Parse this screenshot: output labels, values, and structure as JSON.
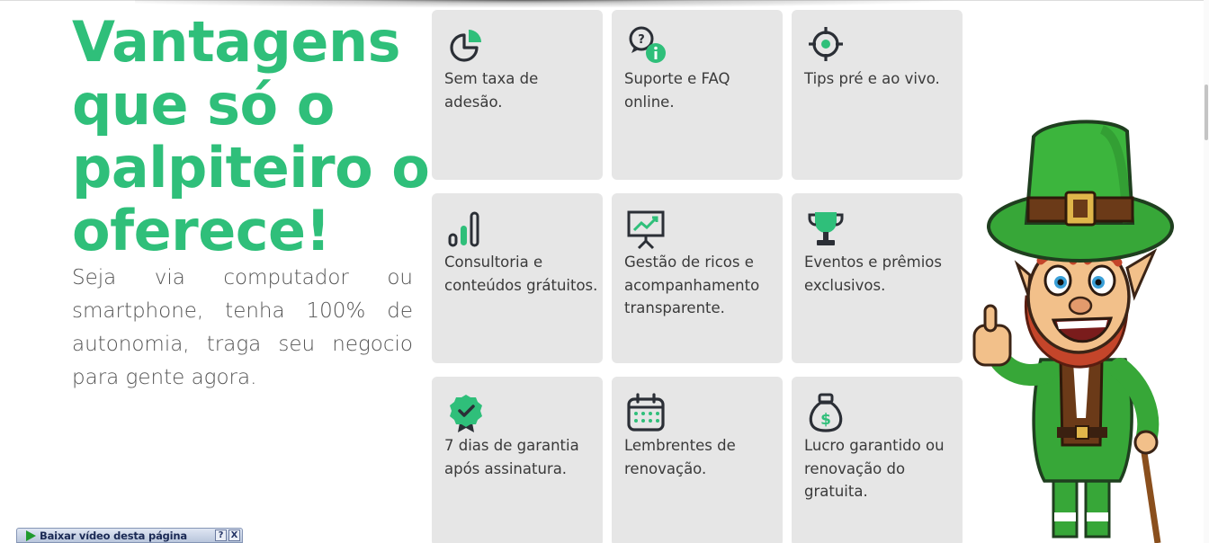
{
  "headline": "Vantagens que só o palpiteiro o oferece!",
  "subtext": "Seja via computador ou smartphone, tenha 100% de autonomia, traga seu negocio para gente agora.",
  "colors": {
    "accent": "#2fbf7a",
    "card_bg": "#e6e6e6",
    "icon_dark": "#2b2f36"
  },
  "cards": [
    {
      "icon": "pie-chart-icon",
      "label": "Sem taxa de adesão."
    },
    {
      "icon": "help-chat-icon",
      "label": "Suporte e FAQ online."
    },
    {
      "icon": "crosshair-icon",
      "label": "Tips pré e ao vivo."
    },
    {
      "icon": "bar-chart-icon",
      "label": "Consultoria e conteúdos grátuitos."
    },
    {
      "icon": "presentation-chart-icon",
      "label": "Gestão de ricos e acompanhamento transparente."
    },
    {
      "icon": "trophy-icon",
      "label": "Eventos e prêmios exclusivos."
    },
    {
      "icon": "badge-check-icon",
      "label": "7 dias de garantia após assinatura."
    },
    {
      "icon": "calendar-icon",
      "label": "Lembrentes de renovação."
    },
    {
      "icon": "money-bag-icon",
      "label": "Lucro garantido ou renovação do gratuita."
    }
  ],
  "download_bar": {
    "label": "Baixar vídeo desta página",
    "help": "?",
    "close": "X"
  }
}
